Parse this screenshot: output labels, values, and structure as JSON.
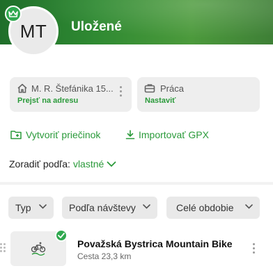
{
  "header": {
    "title": "Uložené",
    "avatar_initials": "MT",
    "badge_icon": "crown-icon",
    "accent_color": "#2fa84f"
  },
  "places": [
    {
      "icon": "home-icon",
      "label": "M. R. Štefánika 15...",
      "action": "Prejsť na adresu"
    },
    {
      "icon": "briefcase-icon",
      "label": "Práca",
      "action": "Nastaviť"
    }
  ],
  "actions": {
    "create_folder": "Vytvoriť priečinok",
    "import_gpx": "Importovať GPX"
  },
  "sort": {
    "label": "Zoradiť podľa:",
    "value": "vlastné"
  },
  "filters": {
    "type": "Typ",
    "visits": "Podľa návštevy",
    "period": "Celé obdobie"
  },
  "routes": [
    {
      "title": "Považská Bystrica Mountain Bike",
      "subtitle": "Cesta 23,3 km",
      "icon": "bicycle-icon",
      "status_icon": "check-icon"
    }
  ]
}
